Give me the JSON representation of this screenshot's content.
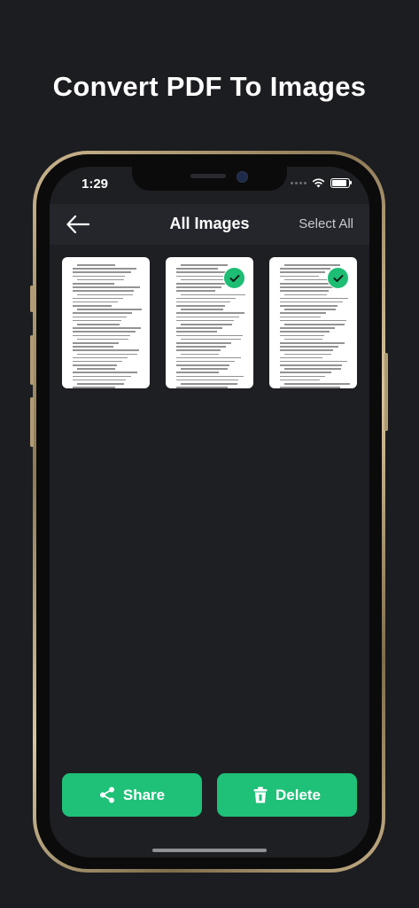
{
  "headline": "Convert PDF To Images",
  "status_bar": {
    "time": "1:29"
  },
  "navbar": {
    "title": "All Images",
    "select_all_label": "Select All"
  },
  "images": [
    {
      "selected": false
    },
    {
      "selected": true
    },
    {
      "selected": true
    }
  ],
  "actions": {
    "share_label": "Share",
    "delete_label": "Delete"
  },
  "colors": {
    "accent": "#1fc078",
    "background": "#1c1d21",
    "navbar": "#25262c"
  },
  "icons": [
    "back-arrow-icon",
    "wifi-icon",
    "battery-icon",
    "checkmark-icon",
    "share-icon",
    "trash-icon"
  ]
}
